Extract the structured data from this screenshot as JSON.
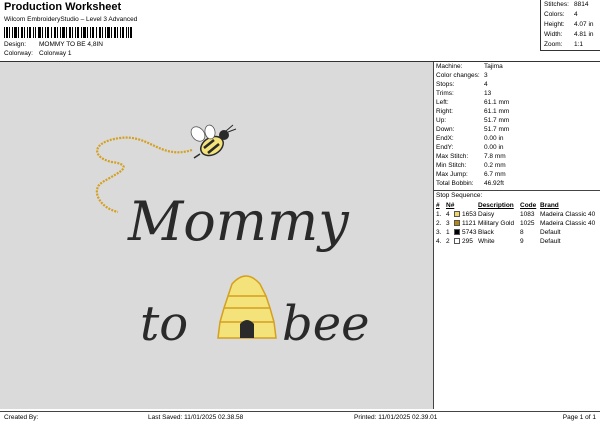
{
  "header": {
    "title": "Production Worksheet",
    "subtitle": "Wilcom EmbroideryStudio – Level 3 Advanced",
    "design_label": "Design:",
    "design_value": "MOMMY TO BE 4,8IN",
    "colorway_label": "Colorway:",
    "colorway_value": "Colorway 1"
  },
  "summary": [
    {
      "label": "Stitches:",
      "value": "8814"
    },
    {
      "label": "Colors:",
      "value": "4"
    },
    {
      "label": "Height:",
      "value": "4.07 in"
    },
    {
      "label": "Width:",
      "value": "4.81 in"
    },
    {
      "label": "Zoom:",
      "value": "1:1"
    }
  ],
  "design_text": {
    "line1": "Mommy",
    "line2a": "to",
    "line2b": "bee"
  },
  "colors": {
    "thread_black": "#2a2a2a",
    "gold": "#d4a020",
    "yellow": "#f4e37a",
    "white": "#ffffff",
    "canvas": "#dadada"
  },
  "details": [
    {
      "label": "Machine:",
      "value": "Tajima"
    },
    {
      "label": "Color changes:",
      "value": "3"
    },
    {
      "label": "Stops:",
      "value": "4"
    },
    {
      "label": "Trims:",
      "value": "13"
    },
    {
      "label": "Left:",
      "value": "61.1 mm"
    },
    {
      "label": "Right:",
      "value": "61.1 mm"
    },
    {
      "label": "Up:",
      "value": "51.7 mm"
    },
    {
      "label": "Down:",
      "value": "51.7 mm"
    },
    {
      "label": "EndX:",
      "value": "0.00 in"
    },
    {
      "label": "EndY:",
      "value": "0.00 in"
    },
    {
      "label": "Max Stitch:",
      "value": "7.8 mm"
    },
    {
      "label": "Min Stitch:",
      "value": "0.2 mm"
    },
    {
      "label": "Max Jump:",
      "value": "6.7 mm"
    },
    {
      "label": "Total Bobbin:",
      "value": "46.92ft"
    }
  ],
  "stop_sequence": {
    "heading": "Stop Sequence:",
    "columns": [
      "#",
      "N#",
      "Description",
      "Code",
      "Brand"
    ],
    "rows": [
      {
        "num": "1.",
        "needle": "4",
        "color": "#f2d46a",
        "code_num": "1653",
        "description": "Daisy",
        "code": "1083",
        "brand": "Madeira Classic 40"
      },
      {
        "num": "2.",
        "needle": "3",
        "color": "#b8860b",
        "code_num": "1121",
        "description": "Military Gold",
        "code": "1025",
        "brand": "Madeira Classic 40"
      },
      {
        "num": "3.",
        "needle": "1",
        "color": "#000000",
        "code_num": "5743",
        "description": "Black",
        "code": "8",
        "brand": "Default"
      },
      {
        "num": "4.",
        "needle": "2",
        "color": "#ffffff",
        "code_num": "295",
        "description": "White",
        "code": "9",
        "brand": "Default"
      }
    ]
  },
  "footer": {
    "created_by": "Created By:",
    "last_saved": "Last Saved: 11/01/2025 02.38.58",
    "printed": "Printed: 11/01/2025 02.39.01",
    "page": "Page 1 of 1"
  }
}
